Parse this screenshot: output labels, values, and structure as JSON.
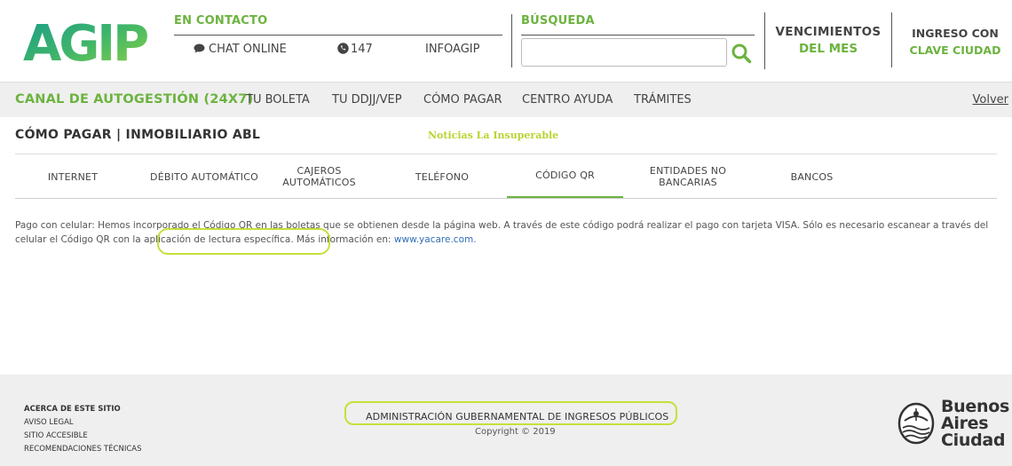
{
  "header": {
    "logo_text": "AGIP",
    "contact_title": "EN CONTACTO",
    "chat_label": "CHAT ONLINE",
    "phone_label": "147",
    "infoagip_label": "INFOAGIP",
    "search_title": "BÚSQUEDA",
    "search_value": "",
    "vencimientos_line1": "VENCIMIENTOS",
    "vencimientos_line2": "DEL MES",
    "ingreso_line1": "INGRESO CON",
    "ingreso_line2": "CLAVE CIUDAD"
  },
  "nav": {
    "brand": "CANAL DE AUTOGESTIÓN (24X7)",
    "items": [
      "TU BOLETA",
      "TU DDJJ/VEP",
      "CÓMO PAGAR",
      "CENTRO AYUDA",
      "TRÁMITES"
    ],
    "back": "Volver"
  },
  "page": {
    "title": "CÓMO PAGAR | INMOBILIARIO ABL",
    "news": "Noticias La Insuperable"
  },
  "tabs": [
    {
      "label": "INTERNET"
    },
    {
      "label": "DÉBITO AUTOMÁTICO"
    },
    {
      "label_l1": "CAJEROS",
      "label_l2": "AUTOMÁTICOS"
    },
    {
      "label": "TELÉFONO"
    },
    {
      "label": "CÓDIGO QR"
    },
    {
      "label_l1": "ENTIDADES NO",
      "label_l2": "BANCARIAS"
    },
    {
      "label": "BANCOS"
    }
  ],
  "active_tab": "CÓDIGO QR",
  "content": {
    "paragraph": "Pago con celular: Hemos incorporado el Código QR en las boletas que se obtienen desde la página web. A través de este código podrá realizar el pago con tarjeta VISA. Sólo es necesario escanear a través del celular el Código QR con la aplicación de lectura específica. ",
    "more_info": "Más información en: ",
    "link": "www.yacare.com."
  },
  "footer": {
    "about": "ACERCA DE ESTE SITIO",
    "legal": "AVISO LEGAL",
    "accessible": "SITIO ACCESIBLE",
    "tech": "RECOMENDACIONES TÉCNICAS",
    "org": "ADMINISTRACIÓN GUBERNAMENTAL DE INGRESOS PÚBLICOS",
    "copyright": "Copyright © 2019",
    "ba_line1": "Buenos",
    "ba_line2": "Aires",
    "ba_line3": "Ciudad"
  },
  "colors": {
    "accent_green": "#6cb33f",
    "highlight": "#c5e03a",
    "link_blue": "#2f6fb5"
  },
  "icons": {
    "chat": "chat-bubble-icon",
    "phone": "phone-icon",
    "search": "magnifier-icon",
    "emblem": "buenos-aires-emblem-icon"
  }
}
